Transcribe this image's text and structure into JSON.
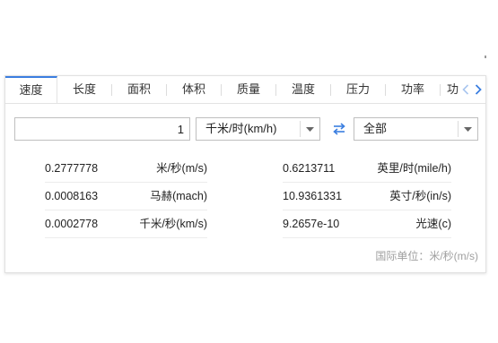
{
  "tabs": [
    {
      "label": "速度",
      "active": true
    },
    {
      "label": "长度",
      "active": false
    },
    {
      "label": "面积",
      "active": false
    },
    {
      "label": "体积",
      "active": false
    },
    {
      "label": "质量",
      "active": false
    },
    {
      "label": "温度",
      "active": false
    },
    {
      "label": "压力",
      "active": false
    },
    {
      "label": "功率",
      "active": false
    },
    {
      "label": "功",
      "active": false
    }
  ],
  "input": {
    "value": "1"
  },
  "from_unit": {
    "selected": "千米/时(km/h)"
  },
  "to_unit": {
    "selected": "全部"
  },
  "results": {
    "left": [
      {
        "value": "0.2777778",
        "unit": "米/秒(m/s)"
      },
      {
        "value": "0.0008163",
        "unit": "马赫(mach)"
      },
      {
        "value": "0.0002778",
        "unit": "千米/秒(km/s)"
      }
    ],
    "right": [
      {
        "value": "0.6213711",
        "unit": "英里/时(mile/h)"
      },
      {
        "value": "10.9361331",
        "unit": "英寸/秒(in/s)"
      },
      {
        "value": "9.2657e-10",
        "unit": "光速(c)"
      }
    ]
  },
  "footer": {
    "si_unit": "国际单位：米/秒(m/s)"
  },
  "colors": {
    "accent": "#3a7ee0",
    "border": "#bfbfbf",
    "muted": "#a0a0a0"
  }
}
